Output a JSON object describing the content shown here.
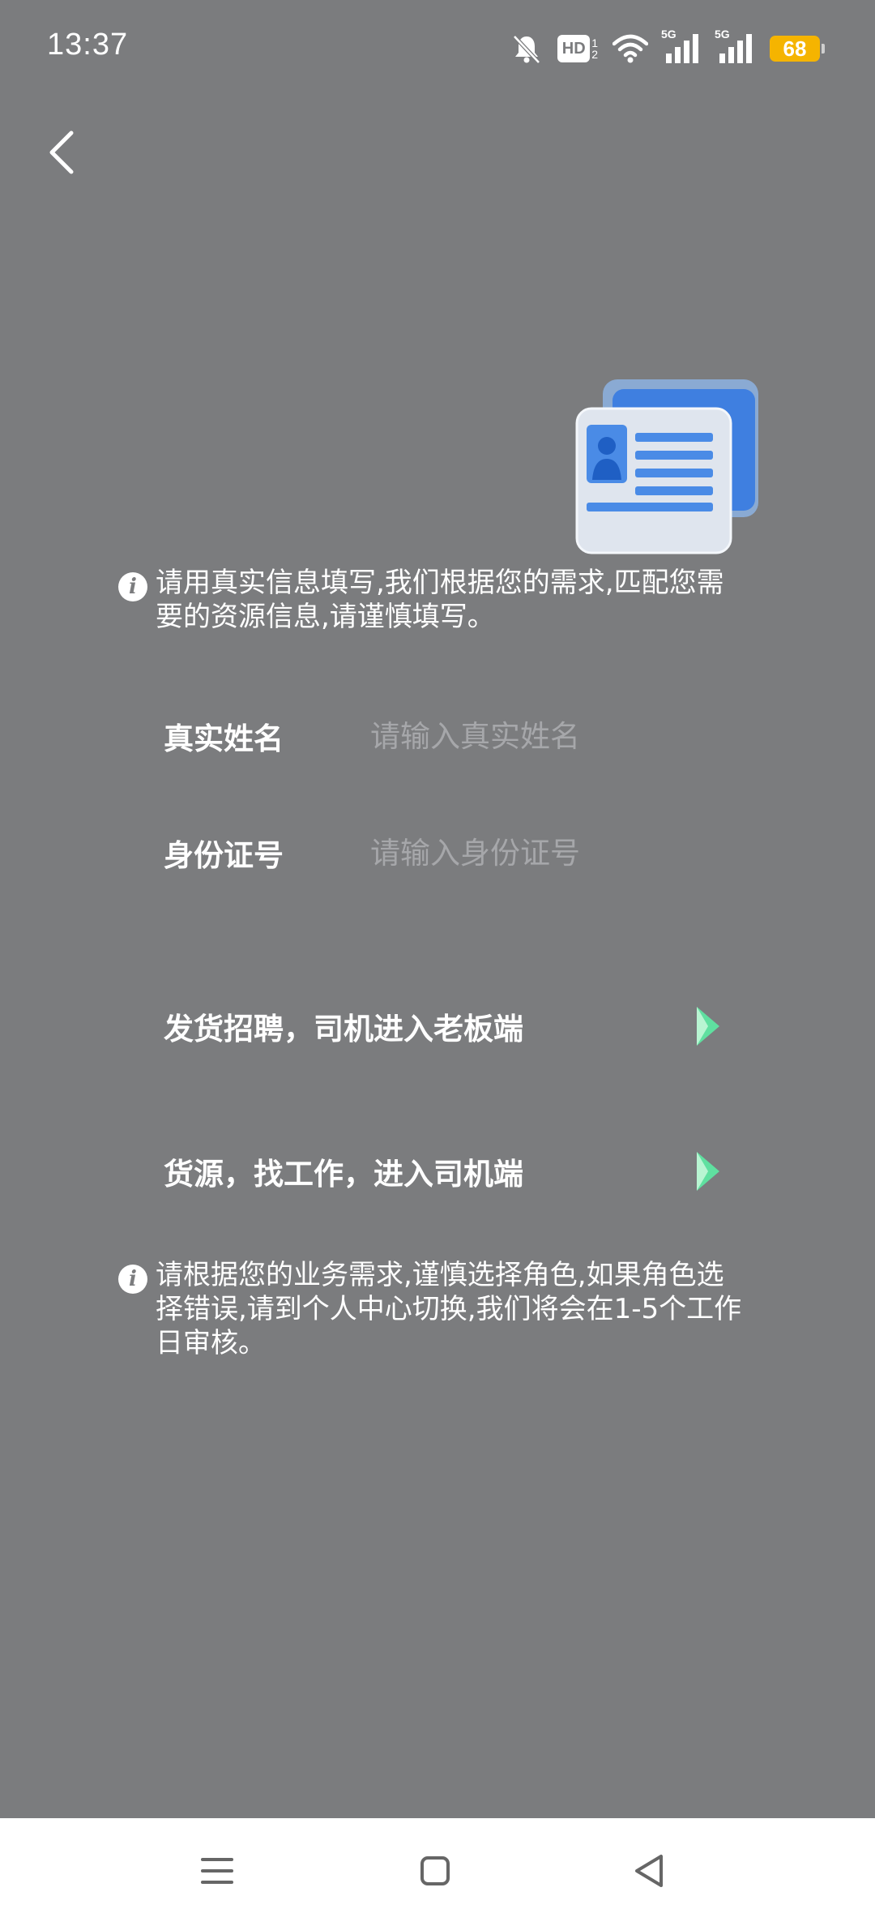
{
  "status_bar": {
    "time": "13:37",
    "hd_label": "HD",
    "hd_sub": "1\n2",
    "signal1_label": "5G",
    "signal2_label": "5G",
    "battery": "68",
    "icons": [
      "bell-muted-icon",
      "hd-icon",
      "wifi-icon",
      "signal-5g-icon",
      "signal-5g-icon",
      "battery-icon"
    ]
  },
  "header": {
    "back_icon": "chevron-left-icon"
  },
  "notice_top": {
    "icon": "info-icon",
    "icon_glyph": "i",
    "text": "请用真实信息填写,我们根据您的需求,匹配您需要的资源信息,请谨慎填写。"
  },
  "form": {
    "name_label": "真实姓名",
    "name_placeholder": "请输入真实姓名",
    "name_value": "",
    "id_label": "身份证号",
    "id_placeholder": "请输入身份证号",
    "id_value": ""
  },
  "roles": {
    "boss_label": "发货招聘，司机进入老板端",
    "driver_label": "货源，找工作，进入司机端",
    "arrow_icon": "chevron-right-icon"
  },
  "notice_bottom": {
    "icon": "info-icon",
    "icon_glyph": "i",
    "text": "请根据您的业务需求,谨慎选择角色,如果角色选择错误,请到个人中心切换,我们将会在1-5个工作日审核。"
  },
  "colors": {
    "background": "#7b7c7e",
    "nav_background": "#ffffff",
    "battery": "#f5b400",
    "arrow": "#5fe0a0",
    "card_blue": "#3f7fe0"
  },
  "nav_bar": {
    "icons": [
      "menu-icon",
      "home-square-icon",
      "back-triangle-icon"
    ]
  }
}
